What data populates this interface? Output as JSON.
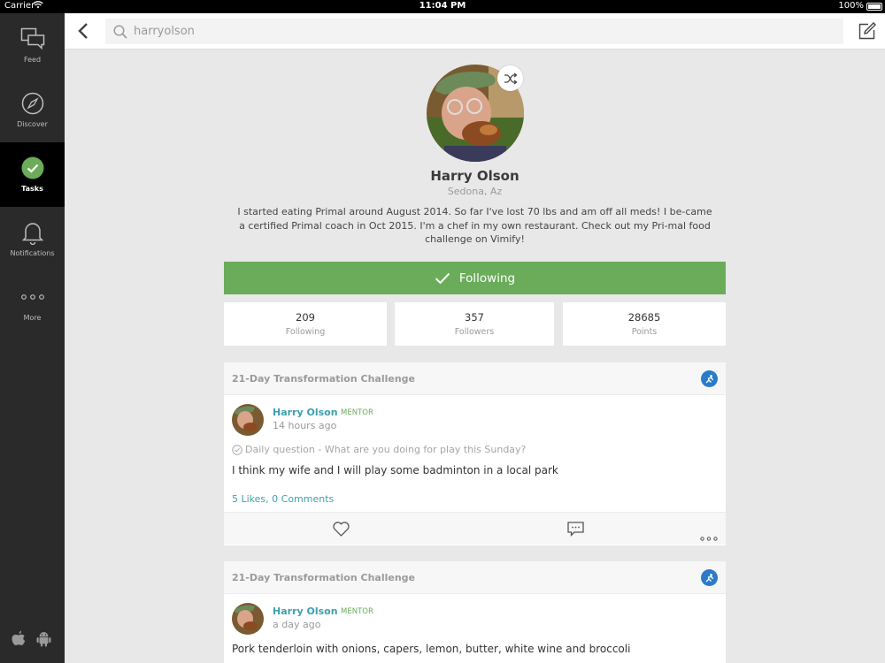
{
  "status_bar": {
    "carrier": "Carrier",
    "time": "11:04 PM",
    "battery": "100%"
  },
  "sidebar": {
    "items": [
      {
        "label": "Feed",
        "icon": "feed-icon"
      },
      {
        "label": "Discover",
        "icon": "compass-icon"
      },
      {
        "label": "Tasks",
        "icon": "check-circle-icon",
        "active": true
      },
      {
        "label": "Notifications",
        "icon": "bell-icon"
      },
      {
        "label": "More",
        "icon": "more-dots-icon"
      }
    ],
    "footer_icons": [
      "apple-icon",
      "android-icon"
    ]
  },
  "search": {
    "value": "harryolson",
    "placeholder": "harryolson"
  },
  "profile": {
    "name": "Harry Olson",
    "location": "Sedona, Az",
    "bio": "I started eating Primal around August 2014. So far I've lost 70 lbs and am off all meds! I be-came a certified Primal coach in Oct 2015. I'm a chef in my own restaurant. Check out my Pri-mal food challenge on Vimify!",
    "follow_label": "Following"
  },
  "stats": [
    {
      "value": "209",
      "label": "Following"
    },
    {
      "value": "357",
      "label": "Followers"
    },
    {
      "value": "28685",
      "label": "Points"
    }
  ],
  "posts": [
    {
      "challenge": "21-Day Transformation Challenge",
      "author": "Harry Olson",
      "role": "MENTOR",
      "time": "14 hours ago",
      "question": "Daily question - What are you doing for play this Sunday?",
      "text": "I think my wife and I will play some badminton in a local park",
      "likes": "5 Likes, 0 Comments"
    },
    {
      "challenge": "21-Day Transformation Challenge",
      "author": "Harry Olson",
      "role": "MENTOR",
      "time": "a day ago",
      "text": "Pork tenderloin with onions, capers, lemon, butter, white wine and broccoli"
    }
  ],
  "colors": {
    "accent_green": "#6aac5a",
    "link_teal": "#3e9fae",
    "sidebar_bg": "#2a2a2a",
    "badge_blue": "#2b7bc8"
  }
}
